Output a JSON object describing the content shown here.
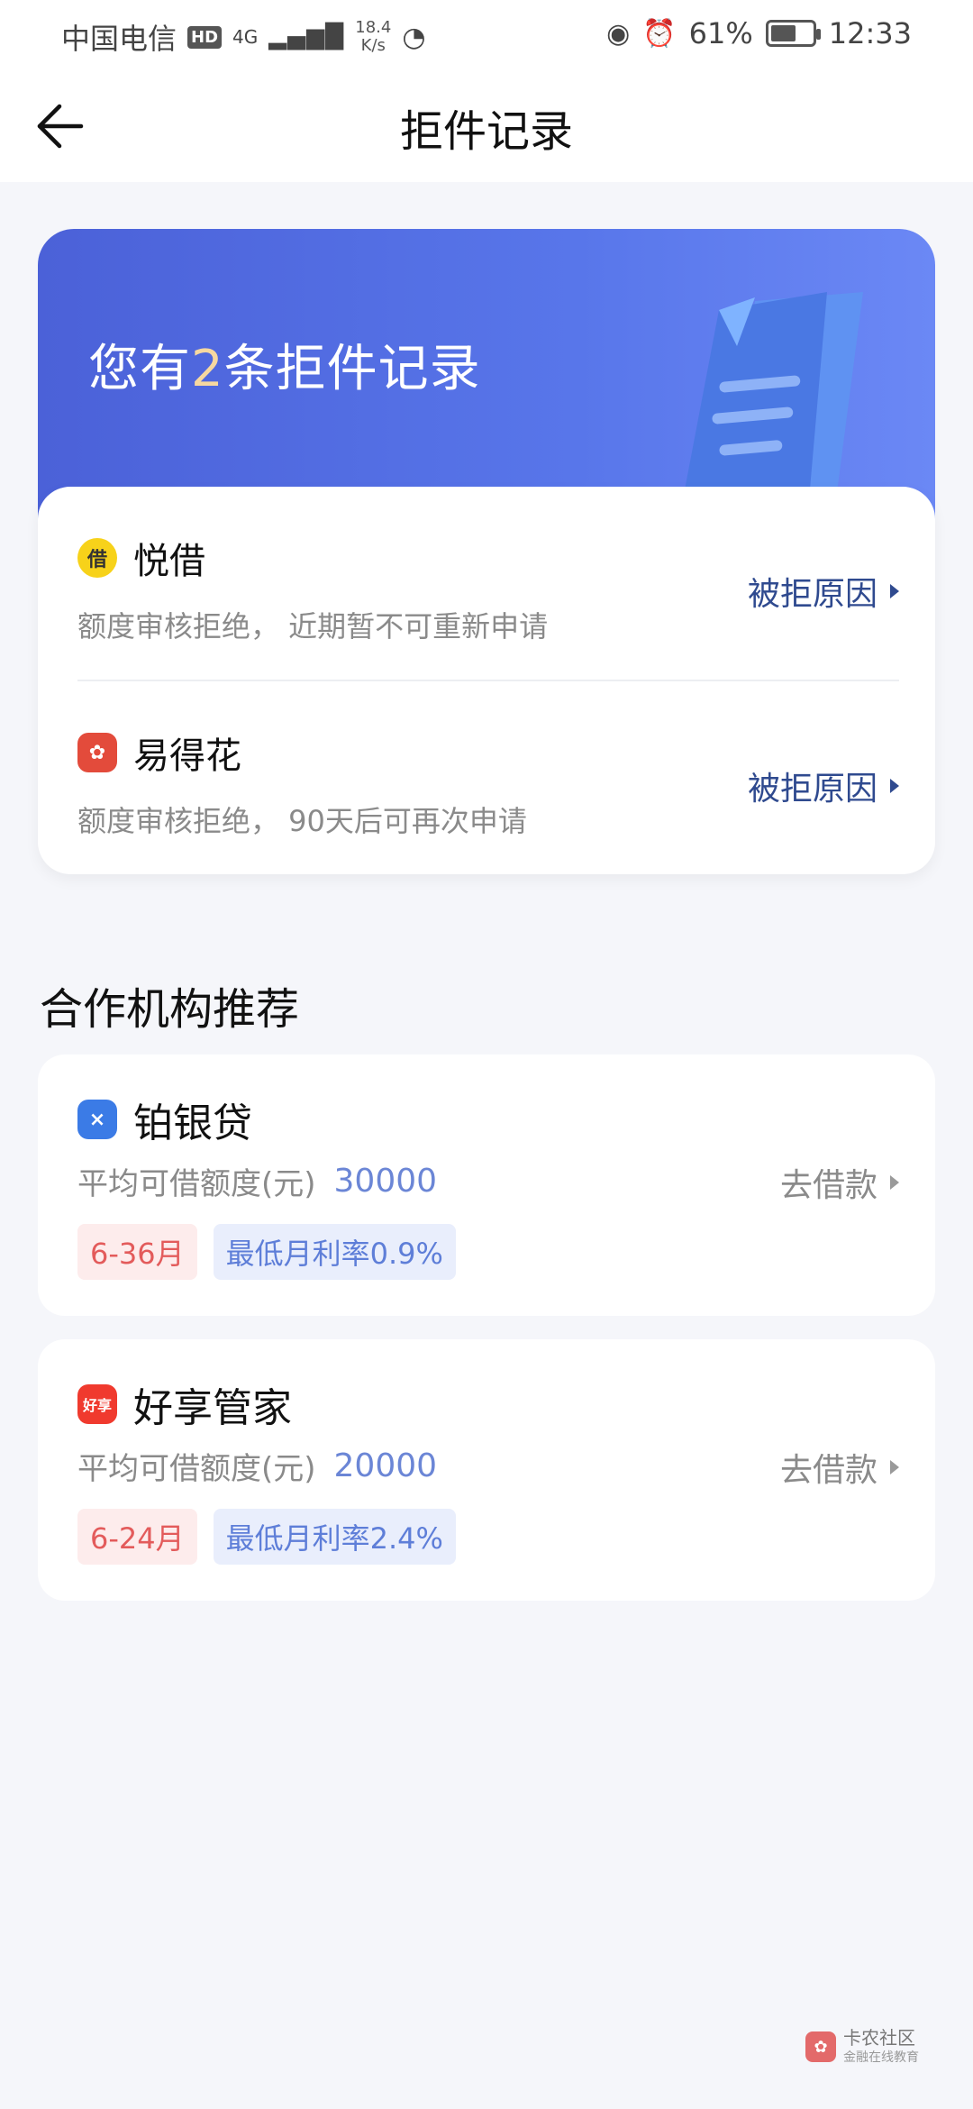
{
  "status_bar": {
    "carrier": "中国电信",
    "hd": "HD",
    "network": "4G",
    "speed_value": "18.4",
    "speed_unit": "K/s",
    "battery_percent": "61%",
    "battery_level": 0.61,
    "time": "12:33"
  },
  "header": {
    "title": "拒件记录"
  },
  "banner": {
    "prefix": "您有",
    "count": "2",
    "suffix": "条拒件记录"
  },
  "rejected": [
    {
      "name": "悦借",
      "desc": "额度审核拒绝， 近期暂不可重新申请",
      "action": "被拒原因",
      "icon": "yuejie-app-icon",
      "icon_glyph": "借",
      "icon_color": "#f7d21a"
    },
    {
      "name": "易得花",
      "desc": "额度审核拒绝， 90天后可再次申请",
      "action": "被拒原因",
      "icon": "yidehua-app-icon",
      "icon_glyph": "✿",
      "icon_color": "#e34b3b"
    }
  ],
  "section_title": "合作机构推荐",
  "recommend": [
    {
      "name": "铂银贷",
      "amount_label": "平均可借额度(元)",
      "amount": "30000",
      "action": "去借款",
      "term_tag": "6-36月",
      "rate_tag": "最低月利率0.9%",
      "icon": "boyindai-app-icon",
      "icon_glyph": "⨯",
      "icon_color": "#3b7be6"
    },
    {
      "name": "好享管家",
      "amount_label": "平均可借额度(元)",
      "amount": "20000",
      "action": "去借款",
      "term_tag": "6-24月",
      "rate_tag": "最低月利率2.4%",
      "icon": "haoxiang-app-icon",
      "icon_glyph": "好享",
      "icon_color": "#f03a2e"
    }
  ],
  "watermark": {
    "title": "卡农社区",
    "subtitle": "金融在线教育"
  }
}
